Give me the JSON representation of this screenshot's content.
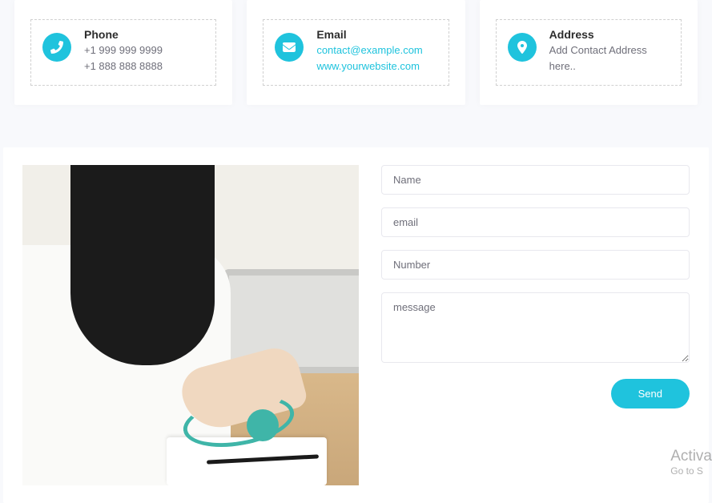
{
  "cards": {
    "phone": {
      "title": "Phone",
      "line1": "+1 999 999 9999",
      "line2": "+1 888 888 8888"
    },
    "email": {
      "title": "Email",
      "link1": "contact@example.com",
      "link2": "www.yourwebsite.com"
    },
    "address": {
      "title": "Address",
      "line1": "Add Contact Address here.."
    }
  },
  "form": {
    "name_placeholder": "Name",
    "email_placeholder": "email",
    "number_placeholder": "Number",
    "message_placeholder": "message",
    "send_label": "Send"
  },
  "watermark": {
    "title": "Activa",
    "subtitle": "Go to S"
  }
}
